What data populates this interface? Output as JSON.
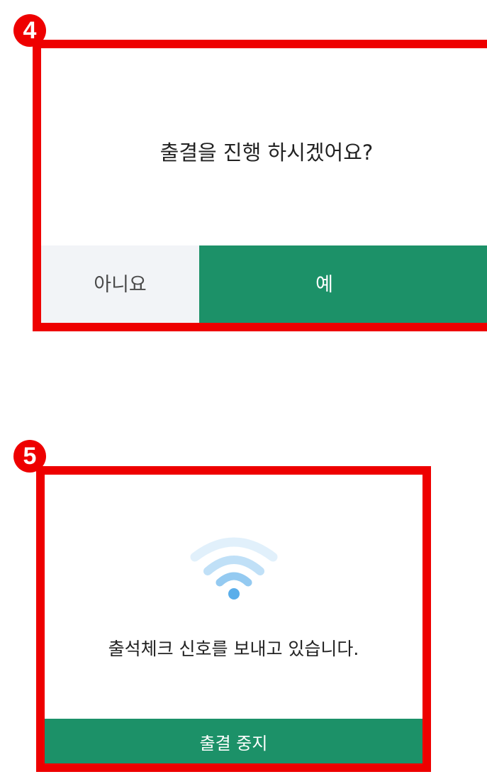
{
  "steps": {
    "confirm": {
      "badge": "4",
      "message": "출결을 진행 하시겠어요?",
      "no_label": "아니요",
      "yes_label": "예"
    },
    "sending": {
      "badge": "5",
      "icon": "wifi-signal-icon",
      "message": "출석체크 신호를 보내고 있습니다.",
      "stop_label": "출결 중지"
    }
  },
  "colors": {
    "highlight": "#ee0000",
    "primary": "#1c9168",
    "secondary_bg": "#f2f4f7",
    "wifi": "#5aaeea"
  }
}
